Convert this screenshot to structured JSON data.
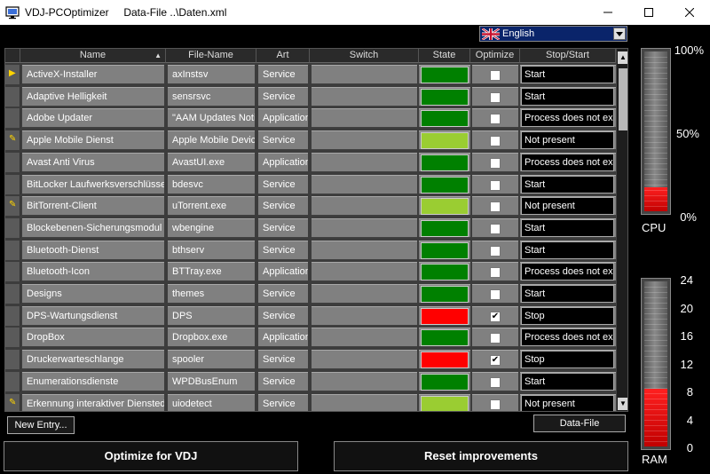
{
  "window": {
    "title": "VDJ-PCOptimizer     Data-File ..\\Daten.xml"
  },
  "language": {
    "value": "English"
  },
  "columns": [
    "Name",
    "File-Name",
    "Art",
    "Switch",
    "State",
    "Optimize",
    "Stop/Start"
  ],
  "rows": [
    {
      "name": "ActiveX-Installer",
      "file": "axInstsv",
      "art": "Service",
      "state": "green",
      "optimize": false,
      "action": "Start",
      "marker": "arrow"
    },
    {
      "name": "Adaptive Helligkeit",
      "file": "sensrsvc",
      "art": "Service",
      "state": "green",
      "optimize": false,
      "action": "Start",
      "marker": ""
    },
    {
      "name": "Adobe Updater",
      "file": "\"AAM Updates Notifi",
      "art": "Application",
      "state": "green",
      "optimize": false,
      "action": "Process does not exis",
      "marker": ""
    },
    {
      "name": "Apple Mobile Dienst",
      "file": "Apple Mobile Device",
      "art": "Service",
      "state": "lightgreen",
      "optimize": false,
      "action": "Not present",
      "marker": "pencil"
    },
    {
      "name": "Avast Anti Virus",
      "file": "AvastUI.exe",
      "art": "Application",
      "state": "green",
      "optimize": false,
      "action": "Process does not exis",
      "marker": ""
    },
    {
      "name": "BitLocker Laufwerksverschlüsselu",
      "file": "bdesvc",
      "art": "Service",
      "state": "green",
      "optimize": false,
      "action": "Start",
      "marker": ""
    },
    {
      "name": "BitTorrent-Client",
      "file": "uTorrent.exe",
      "art": "Service",
      "state": "lightgreen",
      "optimize": false,
      "action": "Not present",
      "marker": "pencil"
    },
    {
      "name": "Blockebenen-Sicherungsmodul",
      "file": "wbengine",
      "art": "Service",
      "state": "green",
      "optimize": false,
      "action": "Start",
      "marker": ""
    },
    {
      "name": "Bluetooth-Dienst",
      "file": "bthserv",
      "art": "Service",
      "state": "green",
      "optimize": false,
      "action": "Start",
      "marker": ""
    },
    {
      "name": "Bluetooth-Icon",
      "file": "BTTray.exe",
      "art": "Application",
      "state": "green",
      "optimize": false,
      "action": "Process does not exis",
      "marker": ""
    },
    {
      "name": "Designs",
      "file": "themes",
      "art": "Service",
      "state": "green",
      "optimize": false,
      "action": "Start",
      "marker": ""
    },
    {
      "name": "DPS-Wartungsdienst",
      "file": "DPS",
      "art": "Service",
      "state": "red",
      "optimize": true,
      "action": "Stop",
      "marker": ""
    },
    {
      "name": "DropBox",
      "file": "Dropbox.exe",
      "art": "Application",
      "state": "green",
      "optimize": false,
      "action": "Process does not exis",
      "marker": ""
    },
    {
      "name": "Druckerwarteschlange",
      "file": "spooler",
      "art": "Service",
      "state": "red",
      "optimize": true,
      "action": "Stop",
      "marker": ""
    },
    {
      "name": "Enumerationsdienste",
      "file": "WPDBusEnum",
      "art": "Service",
      "state": "green",
      "optimize": false,
      "action": "Start",
      "marker": ""
    },
    {
      "name": "Erkennung interaktiver Dienstedial",
      "file": "uiodetect",
      "art": "Service",
      "state": "lightgreen",
      "optimize": false,
      "action": "Not present",
      "marker": "pencil"
    }
  ],
  "colors": {
    "green": "#008000",
    "lightgreen": "#9acd32",
    "red": "#ff0000"
  },
  "buttons": {
    "new_entry": "New Entry...",
    "data_file": "Data-File",
    "optimize": "Optimize for VDJ",
    "reset": "Reset improvements"
  },
  "cpu": {
    "label": "CPU",
    "scale": [
      "100%",
      "50%",
      "0%"
    ],
    "level": 0.15
  },
  "ram": {
    "label": "RAM",
    "scale": [
      "24",
      "20",
      "16",
      "12",
      "8",
      "4",
      "0"
    ],
    "level": 0.35
  },
  "icons": {
    "row_arrow": "▶",
    "row_pencil": "✎",
    "checkmark": "✔",
    "sort": "▲"
  }
}
